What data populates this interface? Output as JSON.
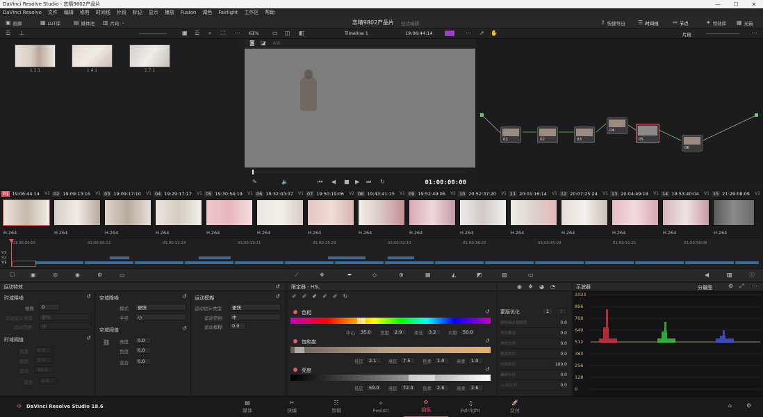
{
  "window": {
    "title": "DaVinci Resolve Studio - 恋晴9802产品片",
    "min": "—",
    "max": "☐",
    "close": "✕"
  },
  "menu": [
    "DaVinci Resolve",
    "文件",
    "编辑",
    "修剪",
    "时间线",
    "片段",
    "标记",
    "显示",
    "播放",
    "Fusion",
    "调色",
    "Fairlight",
    "工作区",
    "帮助"
  ],
  "toolbar": {
    "gallery": "画廊",
    "lut": "LUT库",
    "media": "媒体池",
    "clips": "片段",
    "project_title": "恋晴9802产品片",
    "project_status": "经过编辑",
    "quick_export": "快捷导出",
    "timeline": "时间线",
    "nodes": "节点",
    "effects": "特效库",
    "lightbox": "光箱"
  },
  "subtoolbar": {
    "zoom": "61%",
    "timeline_name": "Timeline 1",
    "timecode": "19:06:44:14",
    "clip_menu": "片段"
  },
  "gallery": {
    "stills": [
      {
        "label": "1.1.1"
      },
      {
        "label": "1.4.1"
      },
      {
        "label": "1.7.1"
      }
    ]
  },
  "viewer": {
    "timecode": "01:00:00:00"
  },
  "nodes": [
    {
      "label": "01"
    },
    {
      "label": "02"
    },
    {
      "label": "03"
    },
    {
      "label": "04"
    },
    {
      "label": "05"
    },
    {
      "label": "06"
    }
  ],
  "clips": [
    {
      "num": "01",
      "tc": "19:06:44:14",
      "track": "V1",
      "codec": "H.264"
    },
    {
      "num": "02",
      "tc": "19:09:13:16",
      "track": "V1",
      "codec": "H.264"
    },
    {
      "num": "03",
      "tc": "19:09:17:10",
      "track": "V1",
      "codec": "H.264"
    },
    {
      "num": "04",
      "tc": "19:29:17:17",
      "track": "V1",
      "codec": "H.264"
    },
    {
      "num": "05",
      "tc": "19:30:54:19",
      "track": "V1",
      "codec": "H.264"
    },
    {
      "num": "06",
      "tc": "19:32:03:07",
      "track": "V1",
      "codec": "H.264"
    },
    {
      "num": "07",
      "tc": "19:50:19:06",
      "track": "V2",
      "codec": "H.264"
    },
    {
      "num": "08",
      "tc": "19:43:41:15",
      "track": "V1",
      "codec": "H.264"
    },
    {
      "num": "09",
      "tc": "19:52:49:06",
      "track": "V2",
      "codec": "H.264"
    },
    {
      "num": "10",
      "tc": "20:52:37:20",
      "track": "V1",
      "codec": "H.264"
    },
    {
      "num": "11",
      "tc": "20:01:16:14",
      "track": "V1",
      "codec": "H.264"
    },
    {
      "num": "12",
      "tc": "20:07:25:24",
      "track": "V1",
      "codec": "H.264"
    },
    {
      "num": "13",
      "tc": "20:04:49:18",
      "track": "V1",
      "codec": "H.264"
    },
    {
      "num": "14",
      "tc": "19:53:40:04",
      "track": "V1",
      "codec": "H.264"
    },
    {
      "num": "15",
      "tc": "21:28:08:09",
      "track": "V1",
      "codec": "H.264"
    }
  ],
  "minitimeline": {
    "ruler": [
      "01:00:00:00",
      "01:00:06:12",
      "01:00:12:24",
      "01:00:19:11",
      "01:00:25:23",
      "01:00:32:10",
      "01:00:38:22",
      "01:00:45:09",
      "01:00:51:21",
      "01:00:58:08"
    ],
    "tracks": [
      "V3",
      "V2",
      "V1"
    ]
  },
  "motion_effects": {
    "title": "运动特效",
    "temporal_nr": "时域降噪",
    "frames_label": "帧数",
    "frames_value": "0",
    "mo_est_type": "运动估计类型",
    "mo_est_value": "更快",
    "mo_range": "运动范围",
    "mo_range_value": "中",
    "spatial_nr": "空域降噪",
    "mode_label": "模式",
    "mode_value": "更快",
    "radius_label": "半径",
    "radius_value": "小",
    "spatial_thr": "空域阈值",
    "luma_label": "亮度",
    "luma_value": "0.0",
    "chroma_label": "色度",
    "chroma_value": "0.0",
    "blend_label": "混合",
    "blend_value": "0.0",
    "temporal_thr": "时域阈值",
    "t_luma": "亮度",
    "t_luma_value": "0.0",
    "t_chroma": "色度",
    "t_chroma_value": "0.0",
    "t_motion": "运动",
    "t_motion_value": "50.0",
    "t_blend": "混合",
    "t_blend_value": "0.0",
    "motion_blur": "运动模糊",
    "mb_est_type": "运动估计类型",
    "mb_est_value": "更快",
    "mb_range": "运动范围",
    "mb_range_value": "中",
    "mb_amount": "运动模糊",
    "mb_amount_value": "0.0"
  },
  "qualifier": {
    "title": "限定器 - HSL",
    "hue": "色相",
    "hue_center": "中心",
    "hue_center_v": "35.0",
    "hue_width": "宽度",
    "hue_width_v": "2.9",
    "hue_soft": "柔化",
    "hue_soft_v": "3.2",
    "hue_sym": "对称",
    "hue_sym_v": "50.0",
    "sat": "饱和度",
    "sat_low": "低区",
    "sat_low_v": "2.1",
    "sat_high": "高区",
    "sat_high_v": "7.5",
    "sat_lsoft": "低柔",
    "sat_lsoft_v": "1.0",
    "sat_hsoft": "高柔",
    "sat_hsoft_v": "1.0",
    "lum": "亮度",
    "lum_low": "低区",
    "lum_low_v": "59.0",
    "lum_high": "高区",
    "lum_high_v": "72.3",
    "lum_lsoft": "低柔",
    "lum_lsoft_v": "2.6",
    "lum_hsoft": "高柔",
    "lum_hsoft_v": "2.6"
  },
  "matte": {
    "title": "蒙版优化",
    "tab1": "1",
    "tab2": "2",
    "rows": [
      {
        "label": "降低噪点粗糙度",
        "value": "0.0"
      },
      {
        "label": "净化黑场",
        "value": "0.0"
      },
      {
        "label": "净化白场",
        "value": "0.0"
      },
      {
        "label": "黑场裁切",
        "value": "0.0"
      },
      {
        "label": "白场裁切",
        "value": "100.0"
      },
      {
        "label": "模糊半径",
        "value": "0.0"
      },
      {
        "label": "入/出比例",
        "value": "0.0"
      }
    ]
  },
  "scope": {
    "title": "示波器",
    "mode": "分量图",
    "ticks": [
      "1023",
      "896",
      "768",
      "640",
      "512",
      "384",
      "256",
      "128",
      "0"
    ]
  },
  "pages": [
    {
      "label": "媒体",
      "icon": "media-page-icon"
    },
    {
      "label": "快编",
      "icon": "cut-page-icon"
    },
    {
      "label": "剪辑",
      "icon": "edit-page-icon"
    },
    {
      "label": "Fusion",
      "icon": "fusion-page-icon"
    },
    {
      "label": "调色",
      "icon": "color-page-icon"
    },
    {
      "label": "Fairlight",
      "icon": "fairlight-page-icon"
    },
    {
      "label": "交付",
      "icon": "deliver-page-icon"
    }
  ],
  "brand": "DaVinci Resolve Studio 18.6",
  "colors": {
    "accent": "#e05a63",
    "clip_selected": "#d23a3a",
    "timeline_clip": "#3a6a99",
    "scope_tick": "#d9b26a"
  }
}
